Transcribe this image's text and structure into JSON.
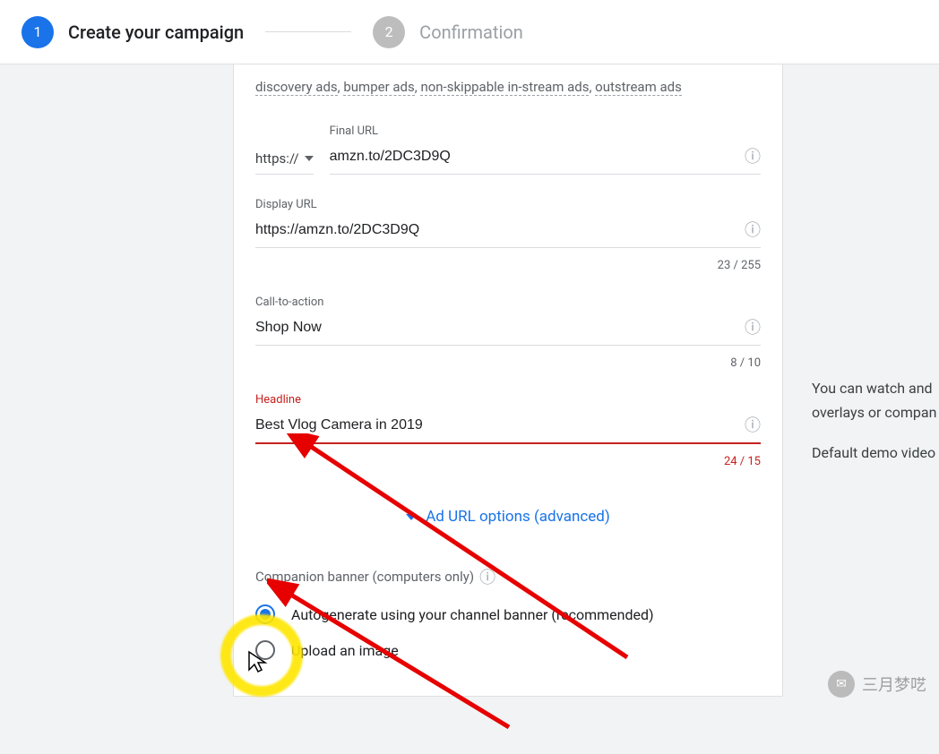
{
  "stepper": {
    "step1_num": "1",
    "step1_label": "Create your campaign",
    "step2_num": "2",
    "step2_label": "Confirmation"
  },
  "ad_types": {
    "discovery": "discovery ads",
    "bumper": "bumper ads",
    "nonskip": "non-skippable in-stream ads",
    "outstream": "outstream ads"
  },
  "final_url": {
    "label": "Final URL",
    "protocol": "https://",
    "value": "amzn.to/2DC3D9Q"
  },
  "display_url": {
    "label": "Display URL",
    "value": "https://amzn.to/2DC3D9Q",
    "counter": "23 / 255"
  },
  "cta": {
    "label": "Call-to-action",
    "value": "Shop Now",
    "counter": "8 / 10"
  },
  "headline": {
    "label": "Headline",
    "value": "Best Vlog Camera in 2019",
    "counter": "24 / 15"
  },
  "expand_label": "Ad URL options (advanced)",
  "companion": {
    "heading": "Companion banner (computers only)",
    "opt_auto": "Autogenerate using your channel banner (recommended)",
    "opt_upload": "Upload an image"
  },
  "side_hint": {
    "line1": "You can watch and",
    "line2": "overlays or compan",
    "line3": "Default demo video"
  },
  "watermark": "三月梦呓"
}
